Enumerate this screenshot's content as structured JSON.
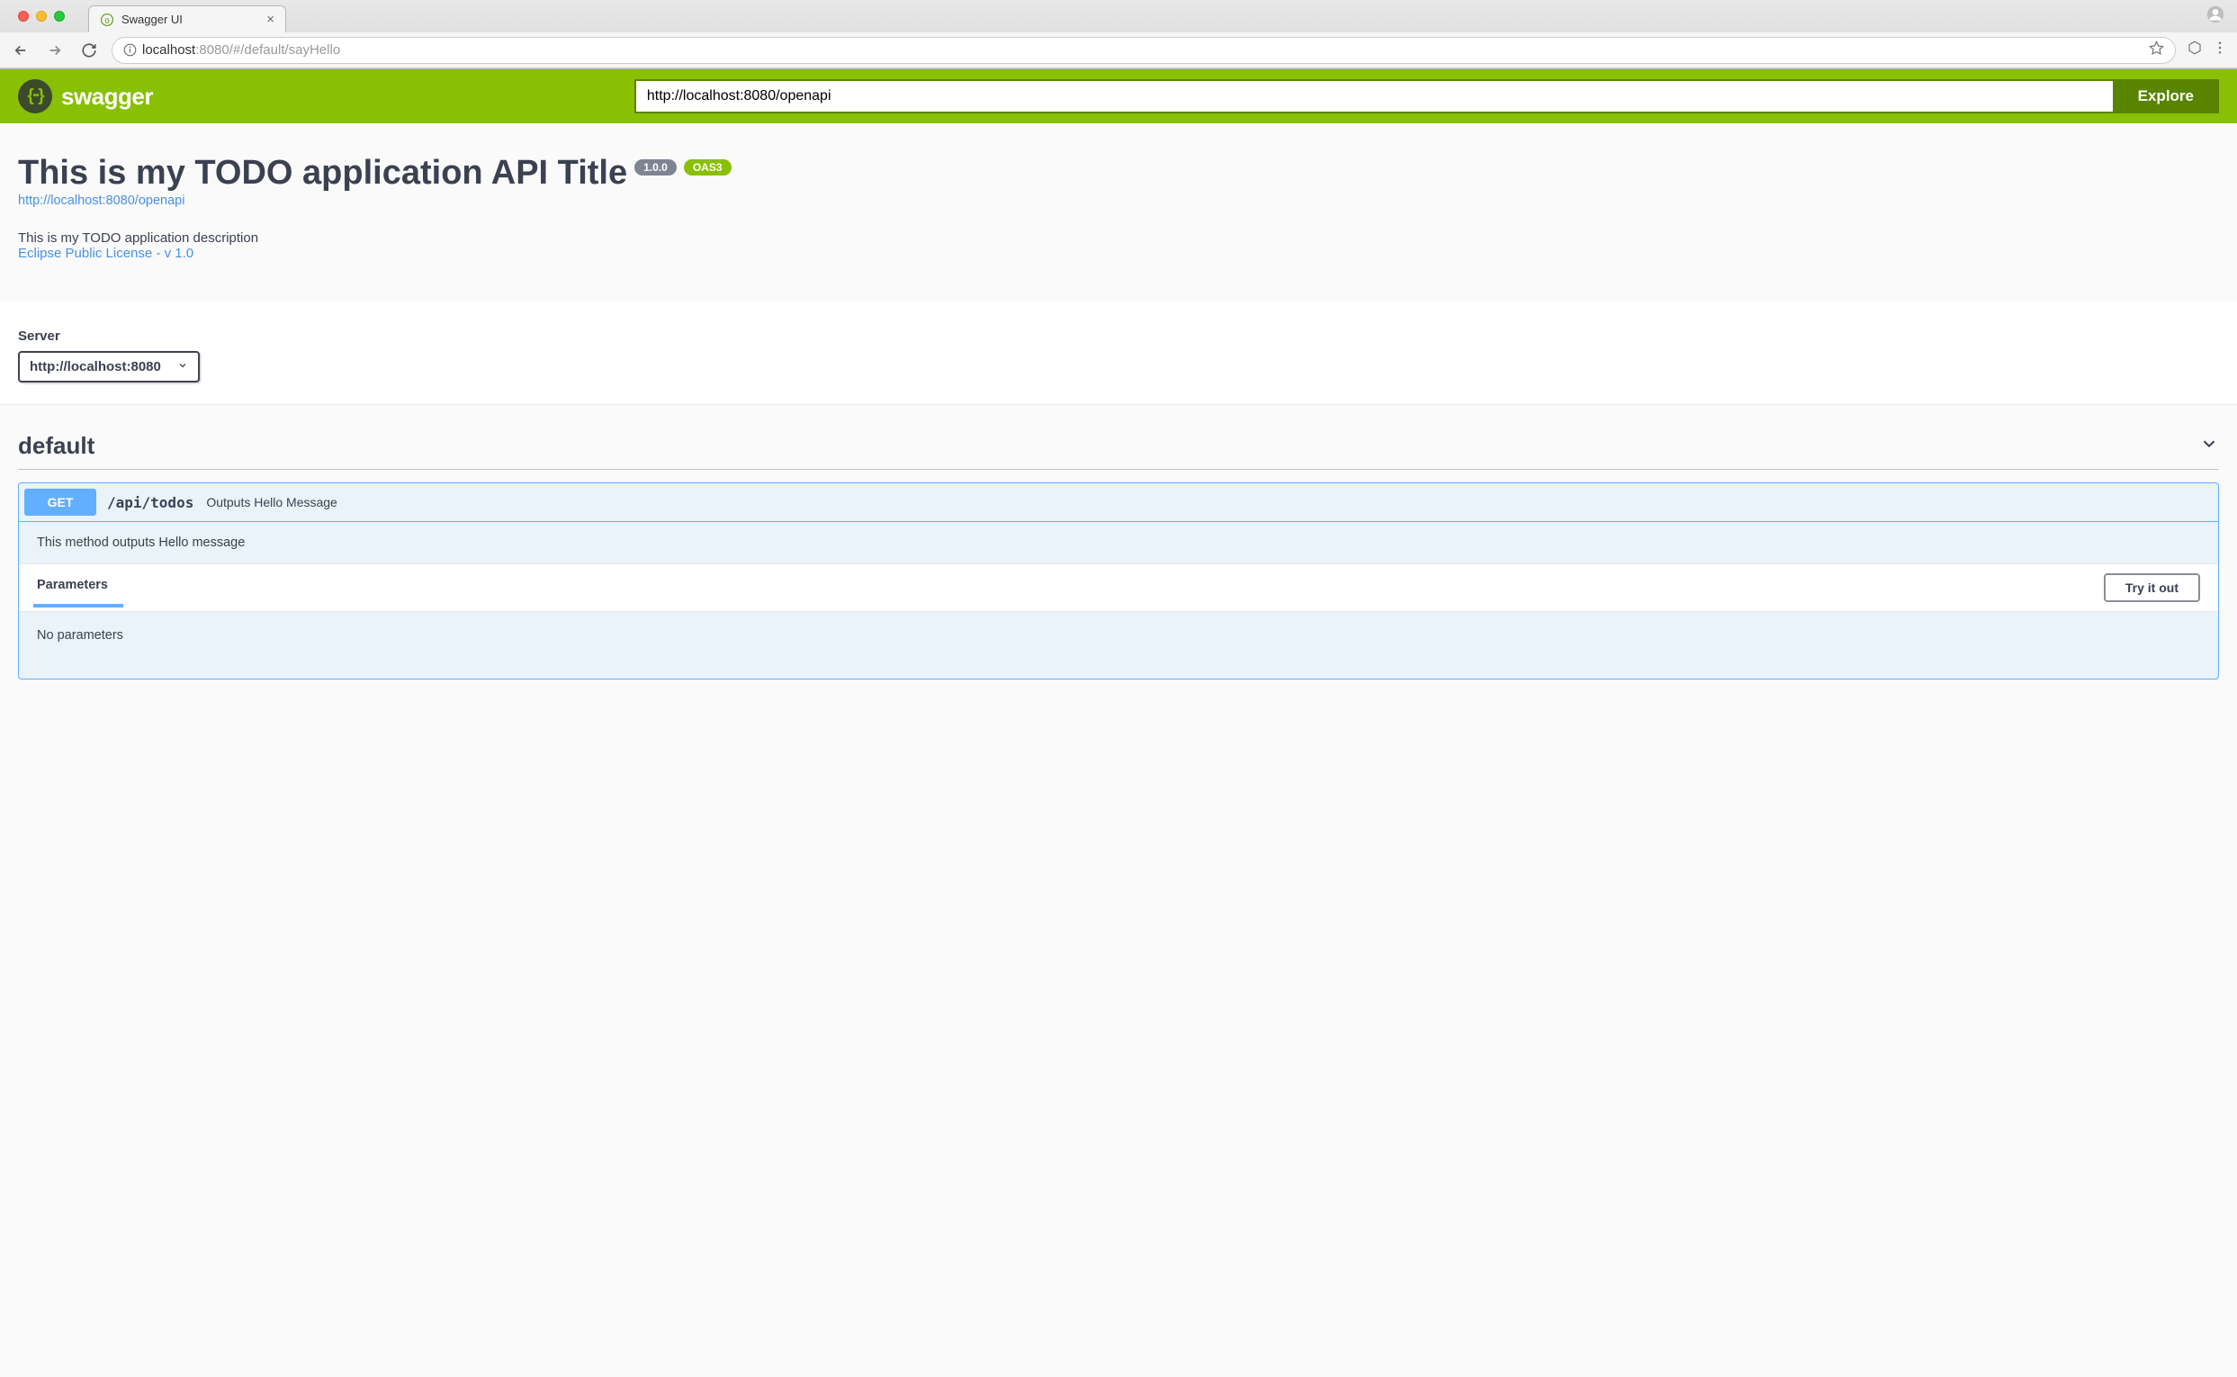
{
  "browser": {
    "tab_title": "Swagger UI",
    "url_host": "localhost",
    "url_port": ":8080",
    "url_path": "/#/default/sayHello"
  },
  "topbar": {
    "logo_text": "swagger",
    "spec_url": "http://localhost:8080/openapi",
    "explore_label": "Explore"
  },
  "info": {
    "title": "This is my TODO application API Title",
    "version": "1.0.0",
    "oas_badge": "OAS3",
    "base_url": "http://localhost:8080/openapi",
    "description": "This is my TODO application description",
    "license": "Eclipse Public License - v 1.0"
  },
  "server": {
    "label": "Server",
    "selected": "http://localhost:8080"
  },
  "tag": {
    "name": "default"
  },
  "operation": {
    "method": "GET",
    "path": "/api/todos",
    "summary": "Outputs Hello Message",
    "description": "This method outputs Hello message",
    "parameters_heading": "Parameters",
    "try_label": "Try it out",
    "no_params": "No parameters"
  }
}
